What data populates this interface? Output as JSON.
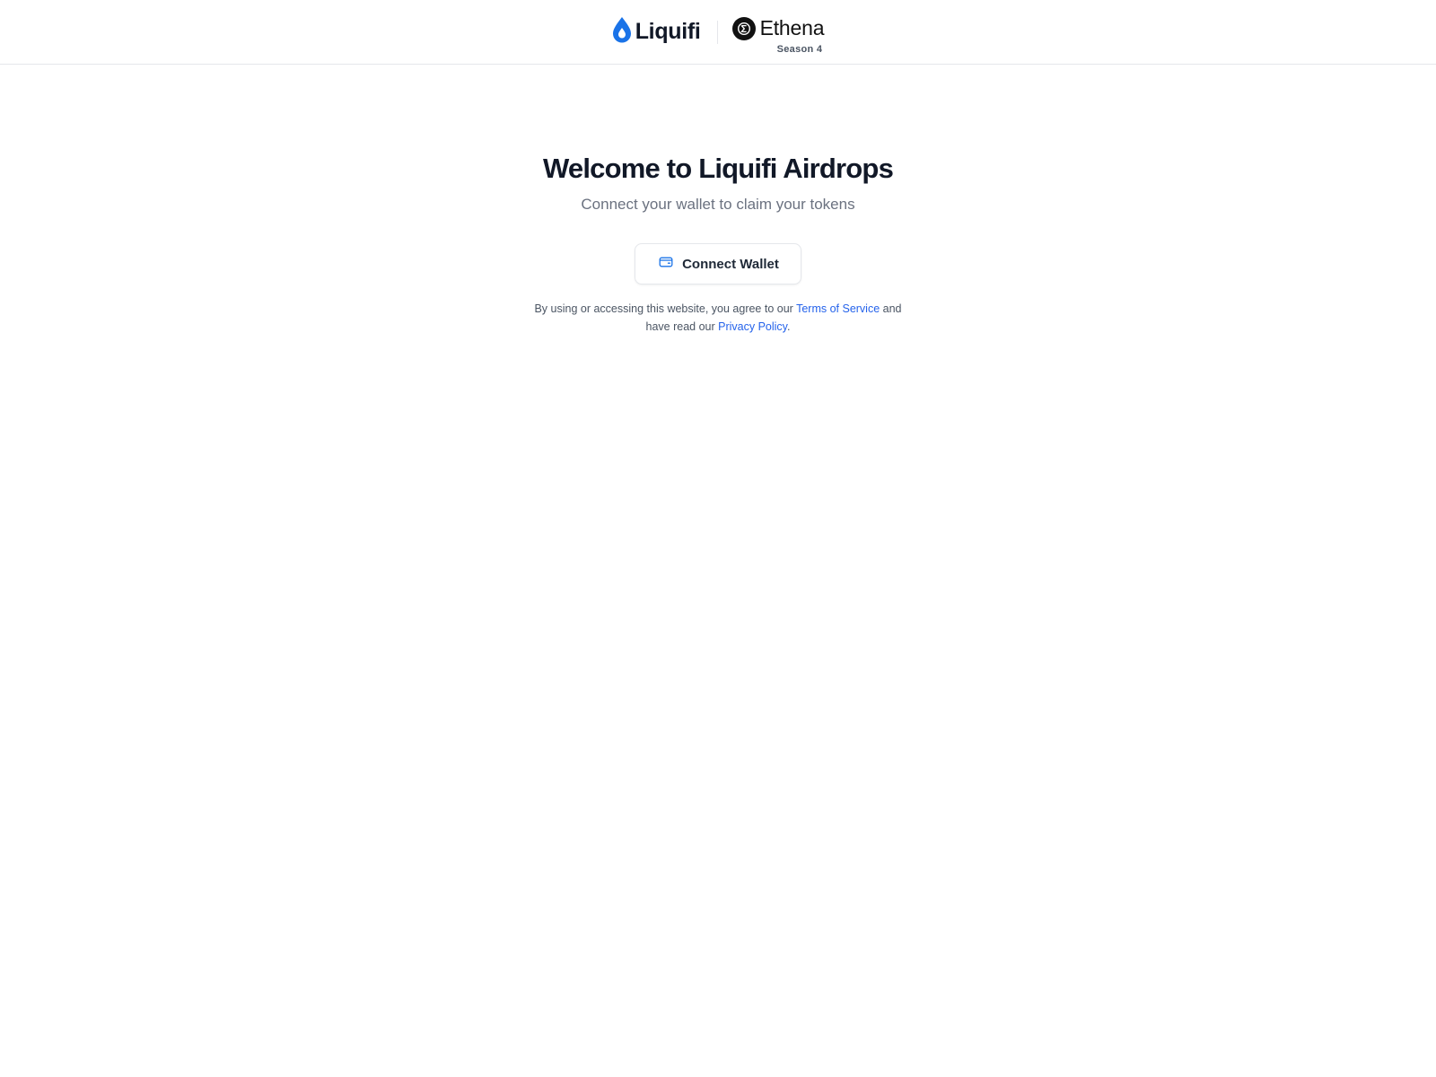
{
  "header": {
    "liquifi_name": "Liquifi",
    "ethena_name": "Ethena",
    "season_label": "Season 4"
  },
  "main": {
    "title": "Welcome to Liquifi Airdrops",
    "subtitle": "Connect your wallet to claim your tokens",
    "connect_button_label": "Connect Wallet",
    "legal": {
      "prefix": "By using or accessing this website, you agree to our",
      "terms_link": "Terms of Service",
      "middle": "and",
      "line2_prefix": "have read our",
      "privacy_link": "Privacy Policy",
      "suffix": "."
    }
  },
  "icons": {
    "liquifi_logo": "droplet-icon",
    "ethena_logo": "ethena-sigma-icon",
    "wallet": "wallet-icon"
  },
  "colors": {
    "brand_blue": "#1a73e8",
    "link_blue": "#2563eb",
    "ethena_black": "#111111",
    "border": "#e5e7eb"
  }
}
